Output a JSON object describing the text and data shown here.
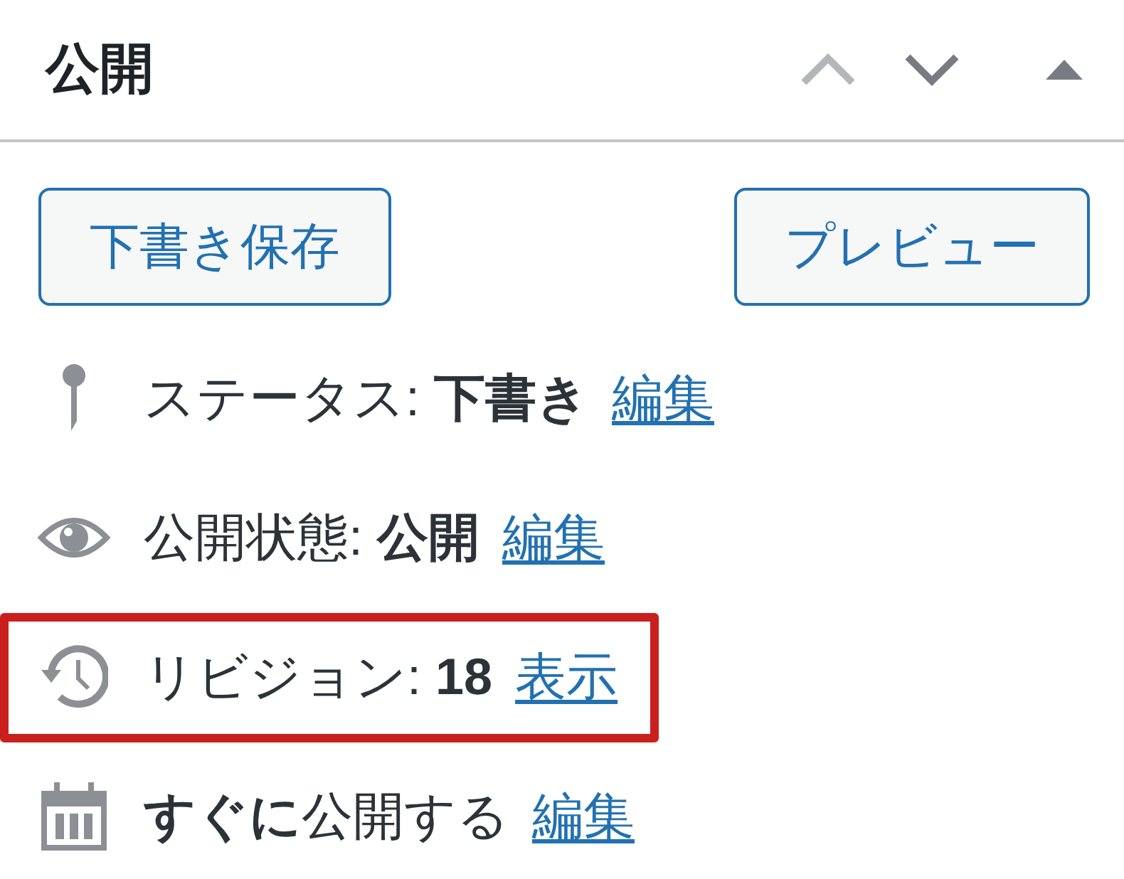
{
  "panel": {
    "title": "公開",
    "controls": [
      {
        "kind": "up",
        "disabled": true
      },
      {
        "kind": "down",
        "disabled": false
      },
      {
        "kind": "toggle",
        "expanded": true
      }
    ]
  },
  "buttons": [
    "下書き保存",
    "プレビュー"
  ],
  "rows": [
    {
      "kind": "status",
      "text": "ステータス: **下書き**",
      "link": "編集",
      "highlighted": false
    },
    {
      "kind": "visibility",
      "text": "公開状態: **公開**",
      "link": "編集",
      "highlighted": false
    },
    {
      "kind": "revisions",
      "text": "リビジョン: **18**",
      "link": "表示",
      "highlighted": true
    },
    {
      "kind": "schedule",
      "text": "**すぐに**公開する",
      "link": "編集",
      "highlighted": false
    }
  ]
}
